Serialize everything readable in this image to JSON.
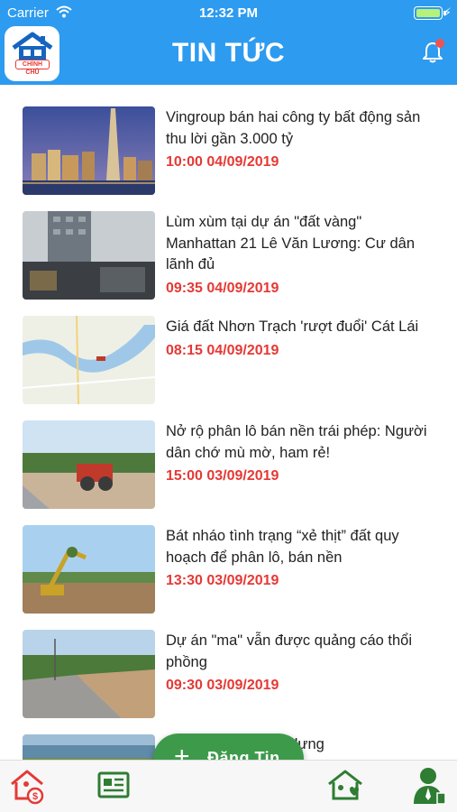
{
  "status_bar": {
    "carrier": "Carrier",
    "time": "12:32 PM",
    "battery_level": 1.0
  },
  "header": {
    "title": "TIN TỨC",
    "logo_text": "CHÍNH CHỦ",
    "logo_icon": "house-logo-icon",
    "notification_icon": "bell-icon",
    "notification_dot": true
  },
  "news": [
    {
      "title": "Vingroup bán hai công ty bất động sản thu lời gần 3.000 tỷ",
      "time": "10:00 04/09/2019",
      "thumb": "city-night-skyline"
    },
    {
      "title": "Lùm xùm tại dự án \"đất vàng\" Manhattan 21 Lê Văn Lương: Cư dân lãnh đủ",
      "time": "09:35 04/09/2019",
      "thumb": "apartment-building"
    },
    {
      "title": "Giá đất Nhơn Trạch 'rượt đuổi' Cát Lái",
      "time": "08:15 04/09/2019",
      "thumb": "river-map"
    },
    {
      "title": "Nở rộ phân lô bán nền trái phép: Người dân chớ mù mờ, ham rẻ!",
      "time": "15:00 03/09/2019",
      "thumb": "roller-on-land"
    },
    {
      "title": "Bát nháo tình trạng “xẻ thịt” đất quy hoạch để phân lô, bán nền",
      "time": "13:30 03/09/2019",
      "thumb": "excavator-on-land"
    },
    {
      "title": "Dự án \"ma\" vẫn được quảng cáo thổi phồng",
      "time": "09:30 03/09/2019",
      "thumb": "empty-road-land"
    },
    {
      "title": "ững xây dựng",
      "time": "",
      "thumb": "coastline"
    }
  ],
  "fab": {
    "label": "Đăng Tin",
    "icon": "plus-icon"
  },
  "tabs": [
    {
      "name": "home-price-icon",
      "color": "#e53935"
    },
    {
      "name": "news-icon",
      "color": "#2e7d32"
    },
    {
      "name": "home-heart-icon",
      "color": "#2e7d32"
    },
    {
      "name": "agent-icon",
      "color": "#2e7d32"
    }
  ],
  "colors": {
    "primary": "#2d9bef",
    "accent_red": "#e53935",
    "accent_green": "#3d9a4b"
  }
}
